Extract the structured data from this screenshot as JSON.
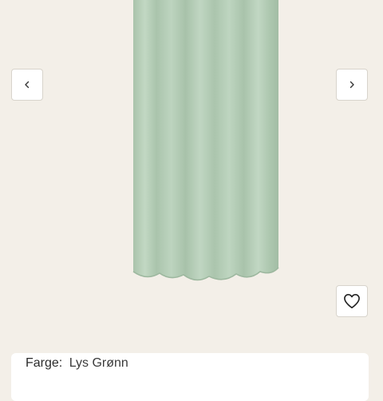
{
  "product": {
    "image_alt_subject": "curtain",
    "curtain_color": "#b5cdb7"
  },
  "gallery": {
    "prev_icon": "chevron-left-icon",
    "next_icon": "chevron-right-icon",
    "favorite_icon": "heart-icon"
  },
  "details": {
    "color_label": "Farge:",
    "color_value": "Lys Grønn"
  }
}
